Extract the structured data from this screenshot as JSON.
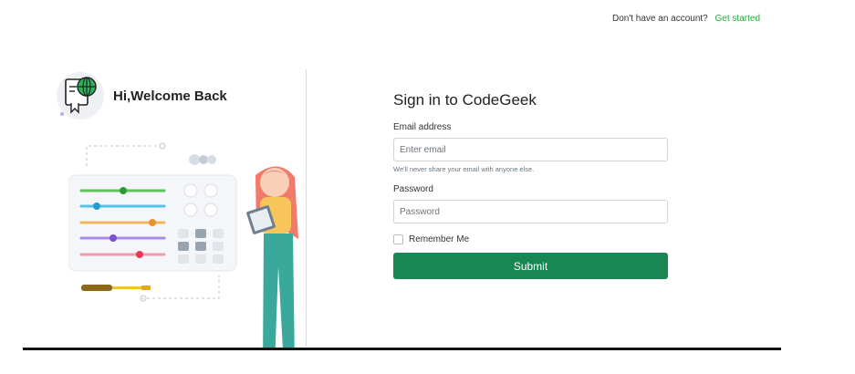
{
  "header": {
    "no_account_text": "Don't have an account?",
    "get_started_link": "Get started"
  },
  "brand": {
    "title": "Hi,Welcome Back"
  },
  "form": {
    "title": "Sign in to CodeGeek",
    "email": {
      "label": "Email address",
      "placeholder": "Enter email",
      "value": "",
      "help": "We'll never share your email with anyone else."
    },
    "password": {
      "label": "Password",
      "placeholder": "Password",
      "value": ""
    },
    "remember_label": "Remember Me",
    "submit_label": "Submit"
  },
  "colors": {
    "accent_green": "#198754",
    "link_green": "#28a745"
  },
  "icons": [
    "globe-certificate-logo-icon",
    "slider-panel-illustration",
    "woman-with-clipboard-illustration"
  ]
}
